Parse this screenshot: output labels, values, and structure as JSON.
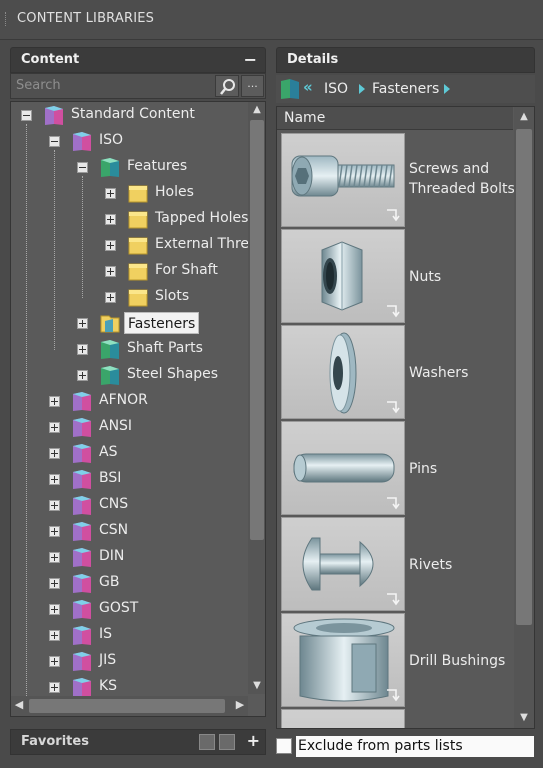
{
  "window": {
    "title": "CONTENT LIBRARIES"
  },
  "content_panel": {
    "title": "Content",
    "collapse_label": "−",
    "search": {
      "placeholder": "Search",
      "more_label": "..."
    },
    "tree": [
      {
        "label": "Standard Content",
        "expanded": true,
        "icon": "library-icon"
      },
      {
        "label": "ISO",
        "expanded": true,
        "icon": "library-icon"
      },
      {
        "label": "Features",
        "expanded": true,
        "icon": "feature-folder-icon"
      },
      {
        "label": "Holes",
        "icon": "folder-icon"
      },
      {
        "label": "Tapped Holes",
        "icon": "folder-icon"
      },
      {
        "label": "External Threa",
        "icon": "folder-icon"
      },
      {
        "label": "For Shaft",
        "icon": "folder-icon"
      },
      {
        "label": "Slots",
        "icon": "folder-icon"
      },
      {
        "label": "Fasteners",
        "icon": "open-folder-icon",
        "selected": true
      },
      {
        "label": "Shaft Parts",
        "icon": "feature-folder-icon"
      },
      {
        "label": "Steel Shapes",
        "icon": "feature-folder-icon"
      },
      {
        "label": "AFNOR",
        "icon": "library-icon"
      },
      {
        "label": "ANSI",
        "icon": "library-icon"
      },
      {
        "label": "AS",
        "icon": "library-icon"
      },
      {
        "label": "BSI",
        "icon": "library-icon"
      },
      {
        "label": "CNS",
        "icon": "library-icon"
      },
      {
        "label": "CSN",
        "icon": "library-icon"
      },
      {
        "label": "DIN",
        "icon": "library-icon"
      },
      {
        "label": "GB",
        "icon": "library-icon"
      },
      {
        "label": "GOST",
        "icon": "library-icon"
      },
      {
        "label": "IS",
        "icon": "library-icon"
      },
      {
        "label": "JIS",
        "icon": "library-icon"
      },
      {
        "label": "KS",
        "icon": "library-icon"
      }
    ]
  },
  "favorites": {
    "title": "Favorites",
    "add_label": "+"
  },
  "details_panel": {
    "title": "Details",
    "breadcrumb": [
      "ISO",
      "Fasteners"
    ],
    "column_header": "Name",
    "items": [
      {
        "label": "Screws and Threaded Bolts",
        "icon": "screw-icon"
      },
      {
        "label": "Nuts",
        "icon": "nut-icon"
      },
      {
        "label": "Washers",
        "icon": "washer-icon"
      },
      {
        "label": "Pins",
        "icon": "pin-icon"
      },
      {
        "label": "Rivets",
        "icon": "rivet-icon"
      },
      {
        "label": "Drill Bushings",
        "icon": "bushing-icon"
      }
    ],
    "exclude_label": "Exclude from parts lists"
  },
  "colors": {
    "accent": "#5ec9d6",
    "panel_bg": "#595959",
    "header_bg": "#3b3b3b"
  }
}
